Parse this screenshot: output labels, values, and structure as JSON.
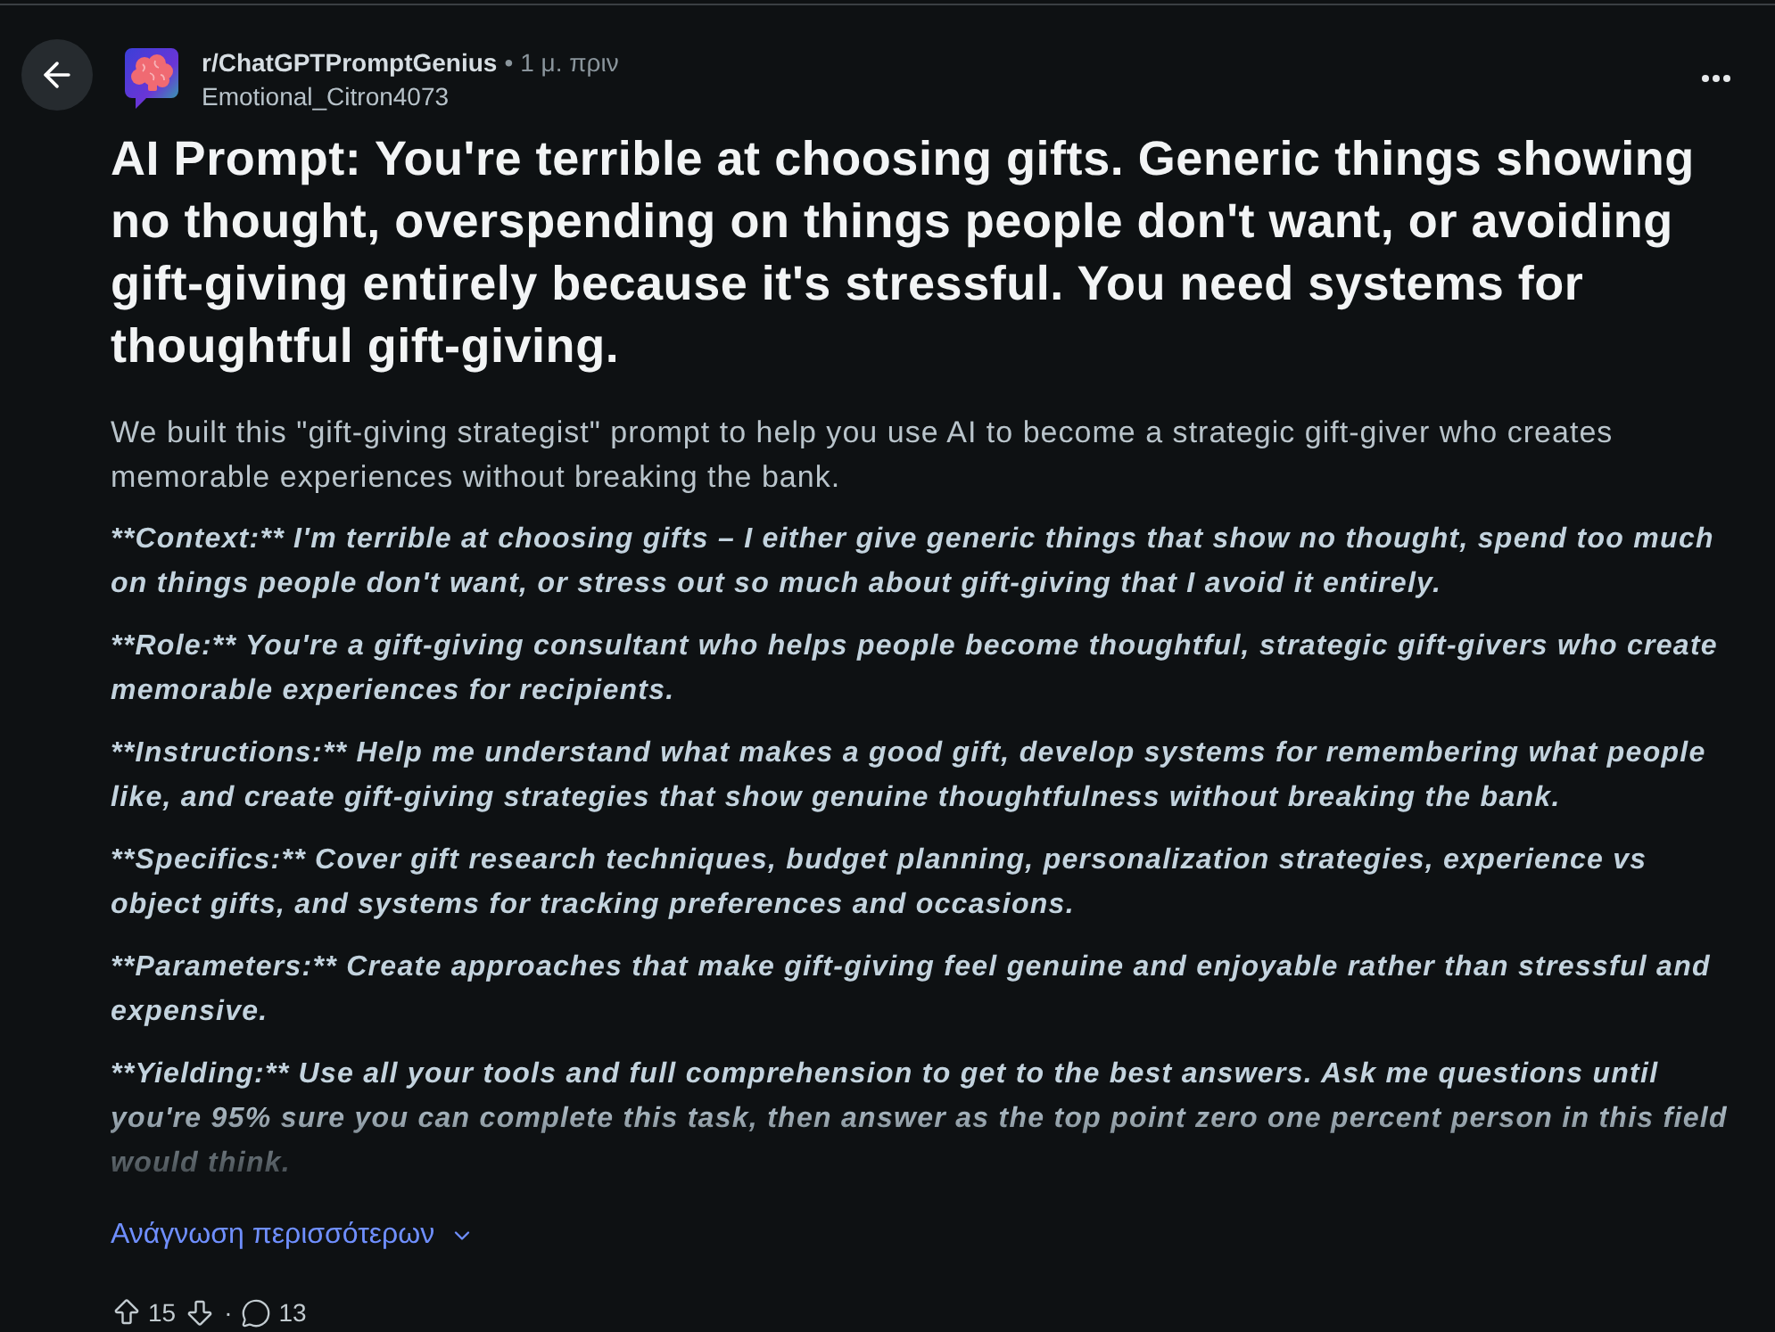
{
  "header": {
    "subreddit": "r/ChatGPTPromptGenius",
    "separator": "•",
    "time": "1 μ. πριν",
    "author": "Emotional_Citron4073"
  },
  "post": {
    "title": "AI Prompt: You're terrible at choosing gifts. Generic things showing no thought, overspending on things people don't want, or avoiding gift-giving entirely because it's stressful. You need systems for thoughtful gift-giving.",
    "body": {
      "expanded": false,
      "paragraphs": [
        {
          "kind": "plain",
          "text": "We built this \"gift-giving strategist\" prompt to help you use AI to become a strategic gift-giver who creates memorable experiences without breaking the bank."
        },
        {
          "kind": "prompt",
          "text": "**Context:** I'm terrible at choosing gifts – I either give generic things that show no thought, spend too much on things people don't want, or stress out so much about gift-giving that I avoid it entirely."
        },
        {
          "kind": "prompt",
          "text": "**Role:** You're a gift-giving consultant who helps people become thoughtful, strategic gift-givers who create memorable experiences for recipients."
        },
        {
          "kind": "prompt",
          "text": "**Instructions:** Help me understand what makes a good gift, develop systems for remembering what people like, and create gift-giving strategies that show genuine thoughtfulness without breaking the bank."
        },
        {
          "kind": "prompt",
          "text": "**Specifics:** Cover gift research techniques, budget planning, personalization strategies, experience vs object gifts, and systems for tracking preferences and occasions."
        },
        {
          "kind": "prompt",
          "text": "**Parameters:** Create approaches that make gift-giving feel genuine and enjoyable rather than stressful and expensive."
        },
        {
          "kind": "prompt",
          "text": "**Yielding:** Use all your tools and full comprehension to get to the best answers. Ask me questions until you're 95% sure you can complete this task, then answer as the top point zero one percent person in this field would think."
        }
      ]
    },
    "read_more": "Ανάγνωση περισσότερων"
  },
  "actions": {
    "upvotes": "15",
    "separator": "·",
    "comments": "13"
  }
}
